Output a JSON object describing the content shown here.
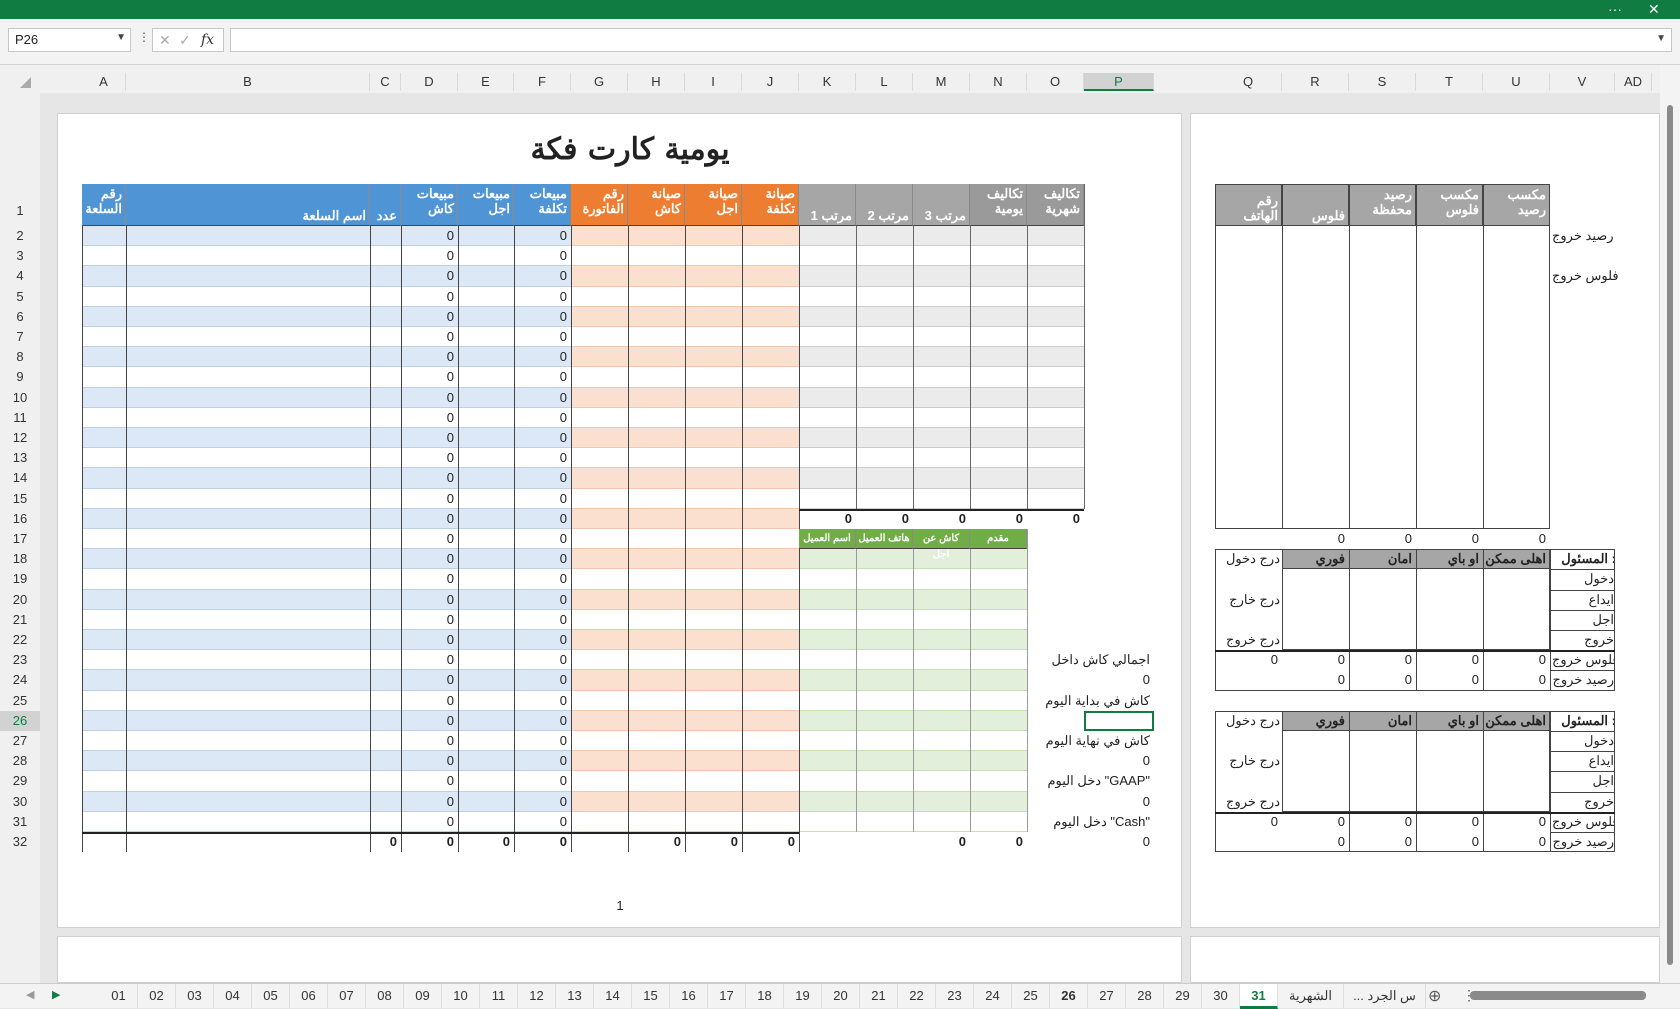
{
  "window": {
    "more_label": "···",
    "close_label": "✕"
  },
  "formula_bar": {
    "name_box": "P26",
    "formula": "",
    "fx_label": "fx"
  },
  "columns": [
    "A",
    "B",
    "C",
    "D",
    "E",
    "F",
    "G",
    "H",
    "I",
    "J",
    "K",
    "L",
    "M",
    "N",
    "O",
    "P",
    "Q",
    "R",
    "S",
    "T",
    "U",
    "V",
    "AD"
  ],
  "rows": [
    "1",
    "2",
    "3",
    "4",
    "5",
    "6",
    "7",
    "8",
    "9",
    "10",
    "11",
    "12",
    "13",
    "14",
    "15",
    "16",
    "17",
    "18",
    "19",
    "20",
    "21",
    "22",
    "23",
    "24",
    "25",
    "26",
    "27",
    "28",
    "29",
    "30",
    "31",
    "32"
  ],
  "title": "يومية كارت فكة",
  "page_number": "1",
  "main_headers": {
    "item_no": "رقم السلعة",
    "item_name": "اسم السلعة",
    "count": "عدد",
    "sales_cash": "مبيعات كاش",
    "sales_credit": "مبيعات اجل",
    "sales_cost": "مبيعات تكلفة",
    "invoice_no": "رقم الفاتورة",
    "maint_cash": "صيانة كاش",
    "maint_credit": "صيانة اجل",
    "maint_cost": "صيانة تكلفة",
    "salary1": "مرتب 1",
    "salary2": "مرتب 2",
    "salary3": "مرتب 3",
    "daily_costs": "تكاليف يومية",
    "monthly_costs": "تكاليف شهرية"
  },
  "zero": "0",
  "green_headers": {
    "advance": "مقدم",
    "cash_credit": "كاش عن اجل",
    "phone": "هاتف العميل",
    "name": "اسم العميل"
  },
  "summary_labels": {
    "total_cash_in": "اجمالي كاش داخل",
    "cash_start": "كاش في بداية اليوم",
    "cash_end": "كاش في نهاية اليوم",
    "gaap_income": "دخل اليوم \"GAAP\"",
    "cash_income": "دخل اليوم \"Cash\""
  },
  "right_headers": {
    "phone_no": "رقم الهاتف",
    "money": "فلوس",
    "wallet_balance": "رصيد محفظة",
    "earn_money": "مكسب فلوس",
    "earn_balance": "مكسب رصيد"
  },
  "right_labels": {
    "balance_out": "رصيد خروج",
    "money_out": "فلوس خروج"
  },
  "resp_block": {
    "responsible": "المسئول :",
    "ahly": "اهلى ممكن",
    "obay": "او باي",
    "aman": "امان",
    "fawry": "فوري",
    "drawer_in": "درج دخول",
    "drawer_out_1": "درج خارج",
    "drawer_exit": "درج خروج",
    "entry": "دخول",
    "deposit": "ايداع",
    "credit": "اجل",
    "exit": "خروج",
    "money_out": "فلوس خروج",
    "balance_out": "رصيد خروج"
  },
  "tabs": [
    "01",
    "02",
    "03",
    "04",
    "05",
    "06",
    "07",
    "08",
    "09",
    "10",
    "11",
    "12",
    "13",
    "14",
    "15",
    "16",
    "17",
    "18",
    "19",
    "20",
    "21",
    "22",
    "23",
    "24",
    "25",
    "26",
    "27",
    "28",
    "29",
    "30",
    "31",
    "الشهرية",
    "... س الجرد"
  ],
  "active_tab": "31",
  "colors": {
    "excel_green": "#107c41",
    "blue": "#4f94d4",
    "orange": "#ed7d31",
    "green": "#70ad47"
  }
}
